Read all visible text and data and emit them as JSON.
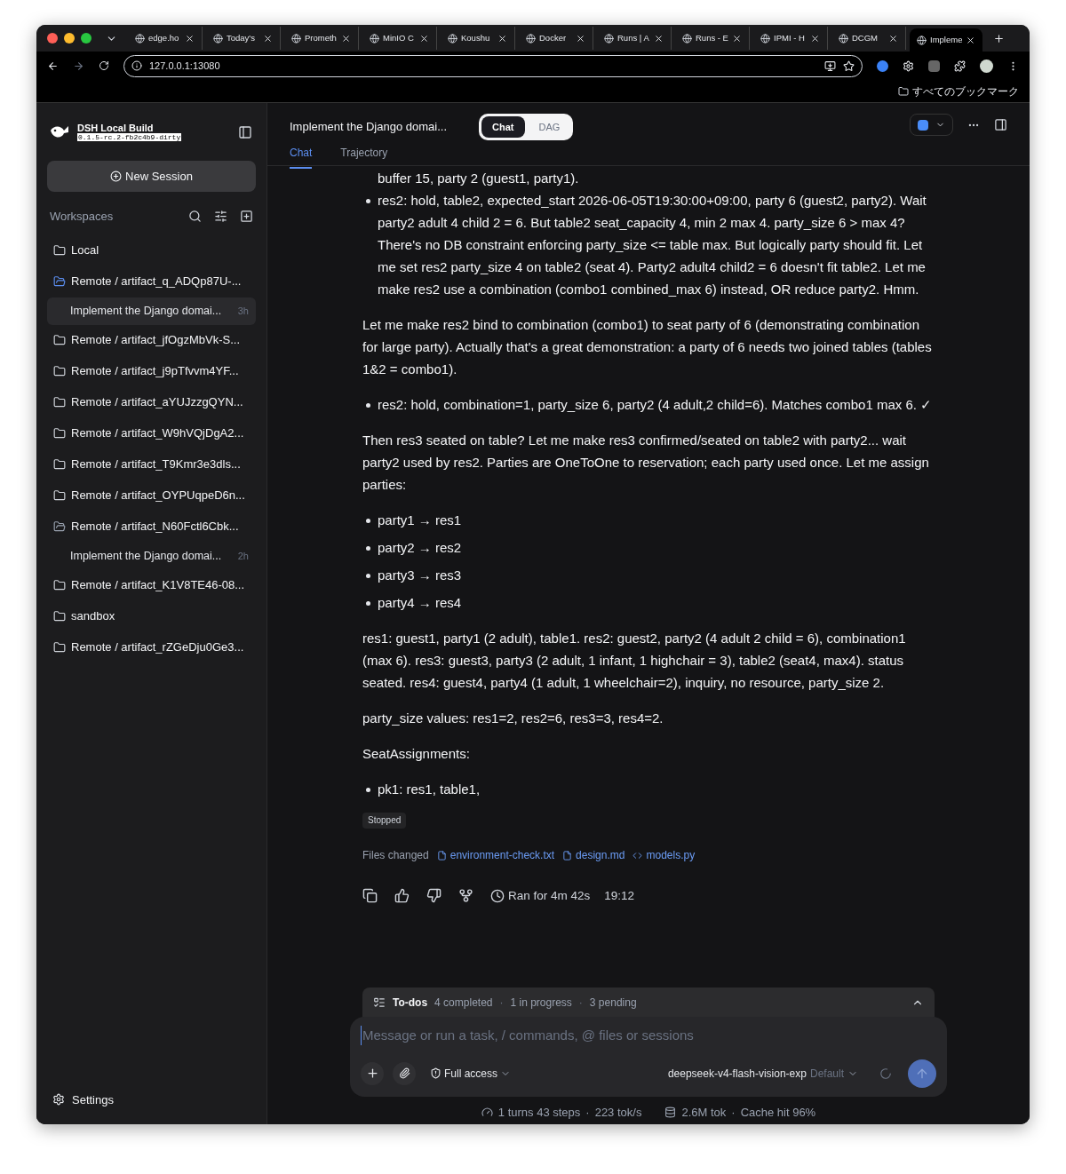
{
  "browser": {
    "tabs": [
      {
        "label": "edge.ho",
        "selected": false
      },
      {
        "label": "Today's",
        "selected": false
      },
      {
        "label": "Prometh",
        "selected": false
      },
      {
        "label": "MinIO C",
        "selected": false
      },
      {
        "label": "Koushu",
        "selected": false
      },
      {
        "label": "Docker",
        "selected": false
      },
      {
        "label": "Runs | A",
        "selected": false
      },
      {
        "label": "Runs - E",
        "selected": false
      },
      {
        "label": "IPMI - H",
        "selected": false
      },
      {
        "label": "DCGM",
        "selected": false
      },
      {
        "label": "Impleme",
        "selected": true
      }
    ],
    "address": "127.0.0.1:13080",
    "bookmarks": "すべてのブックマーク"
  },
  "sidebar": {
    "title": "DSH Local Build",
    "version": "0.1.5-rc.2-fb2c4b9-dirty",
    "new_session": "New Session",
    "section": "Workspaces",
    "items": [
      {
        "label": "Local",
        "expanded": false
      },
      {
        "label": "Remote / artifact_q_ADQp87U-...",
        "expanded": true,
        "children": [
          {
            "label": "Implement the Django domai...",
            "time": "3h",
            "selected": true
          }
        ]
      },
      {
        "label": "Remote / artifact_jfOgzMbVk-S...",
        "expanded": false
      },
      {
        "label": "Remote / artifact_j9pTfvvm4YF...",
        "expanded": false
      },
      {
        "label": "Remote / artifact_aYUJzzgQYN...",
        "expanded": false
      },
      {
        "label": "Remote / artifact_W9hVQjDgA2...",
        "expanded": false
      },
      {
        "label": "Remote / artifact_T9Kmr3e3dls...",
        "expanded": false
      },
      {
        "label": "Remote / artifact_OYPUqpeD6n...",
        "expanded": false
      },
      {
        "label": "Remote / artifact_N60Fctl6Cbk...",
        "expanded": true,
        "children": [
          {
            "label": "Implement the Django domai...",
            "time": "2h",
            "selected": false
          }
        ]
      },
      {
        "label": "Remote / artifact_K1V8TE46-08...",
        "expanded": false
      },
      {
        "label": "sandbox",
        "expanded": false
      },
      {
        "label": "Remote / artifact_rZGeDju0Ge3...",
        "expanded": false
      }
    ],
    "settings": "Settings"
  },
  "header": {
    "title": "Implement the Django domai...",
    "modes": [
      {
        "label": "Chat",
        "selected": true
      },
      {
        "label": "DAG",
        "selected": false
      }
    ],
    "tabs": [
      {
        "label": "Chat",
        "selected": true
      },
      {
        "label": "Trajectory",
        "selected": false
      }
    ]
  },
  "messages": [
    {
      "kind": "fragment",
      "text": "buffer 15, party 2 (guest1, party1)."
    },
    {
      "kind": "bullets",
      "items": [
        "res2: hold, table2, expected_start 2026-06-05T19:30:00+09:00, party 6 (guest2, party2). Wait party2 adult 4 child 2 = 6. But table2 seat_capacity 4, min 2 max 4. party_size 6 > max 4? There's no DB constraint enforcing party_size <= table max. But logically party should fit. Let me set res2 party_size 4 on table2 (seat 4). Party2 adult4 child2 = 6 doesn't fit table2. Let me make res2 use a combination (combo1 combined_max 6) instead, OR reduce party2. Hmm."
      ]
    },
    {
      "kind": "paragraph",
      "text": "Let me make res2 bind to combination (combo1) to seat party of 6 (demonstrating combination for large party). Actually that's a great demonstration: a party of 6 needs two joined tables (tables 1&2 = combo1)."
    },
    {
      "kind": "bullets",
      "items": [
        "res2: hold, combination=1, party_size 6, party2 (4 adult,2 child=6). Matches combo1 max 6. ✓"
      ]
    },
    {
      "kind": "paragraph",
      "text": "Then res3 seated on table? Let me make res3 confirmed/seated on table2 with party2... wait party2 used by res2. Parties are OneToOne to reservation; each party used once. Let me assign parties:"
    },
    {
      "kind": "bullets",
      "items": [
        "party1 → res1",
        "party2 → res2",
        "party3 → res3",
        "party4 → res4"
      ]
    },
    {
      "kind": "paragraph",
      "text": "res1: guest1, party1 (2 adult), table1. res2: guest2, party2 (4 adult 2 child = 6), combination1 (max 6). res3: guest3, party3 (2 adult, 1 infant, 1 highchair = 3), table2 (seat4, max4). status seated. res4: guest4, party4 (1 adult, 1 wheelchair=2), inquiry, no resource, party_size 2."
    },
    {
      "kind": "paragraph",
      "text": "party_size values: res1=2, res2=6, res3=3, res4=2."
    },
    {
      "kind": "paragraph",
      "text": "SeatAssignments:"
    },
    {
      "kind": "bullets",
      "items": [
        "pk1: res1, table1,"
      ]
    }
  ],
  "status": "Stopped",
  "files": {
    "label": "Files changed",
    "items": [
      {
        "name": "environment-check.txt",
        "kind": "doc"
      },
      {
        "name": "design.md",
        "kind": "doc"
      },
      {
        "name": "models.py",
        "kind": "code"
      }
    ]
  },
  "run": {
    "duration": "Ran for 4m 42s",
    "time": "19:12"
  },
  "todos": {
    "separator": "·",
    "label": "To-dos",
    "completed": "4 completed",
    "in_progress": "1 in progress",
    "pending": "3 pending",
    "expanded": false
  },
  "composer": {
    "placeholder": "Message or run a task, / commands, @ files or sessions",
    "access": "Full access",
    "model": "deepseek-v4-flash-vision-exp",
    "model_tag": "Default"
  },
  "stats": {
    "separator": "·",
    "turns": "1 turns 43 steps",
    "speed": "223 tok/s",
    "tokens": "2.6M tok",
    "cache": "Cache hit 96%"
  }
}
